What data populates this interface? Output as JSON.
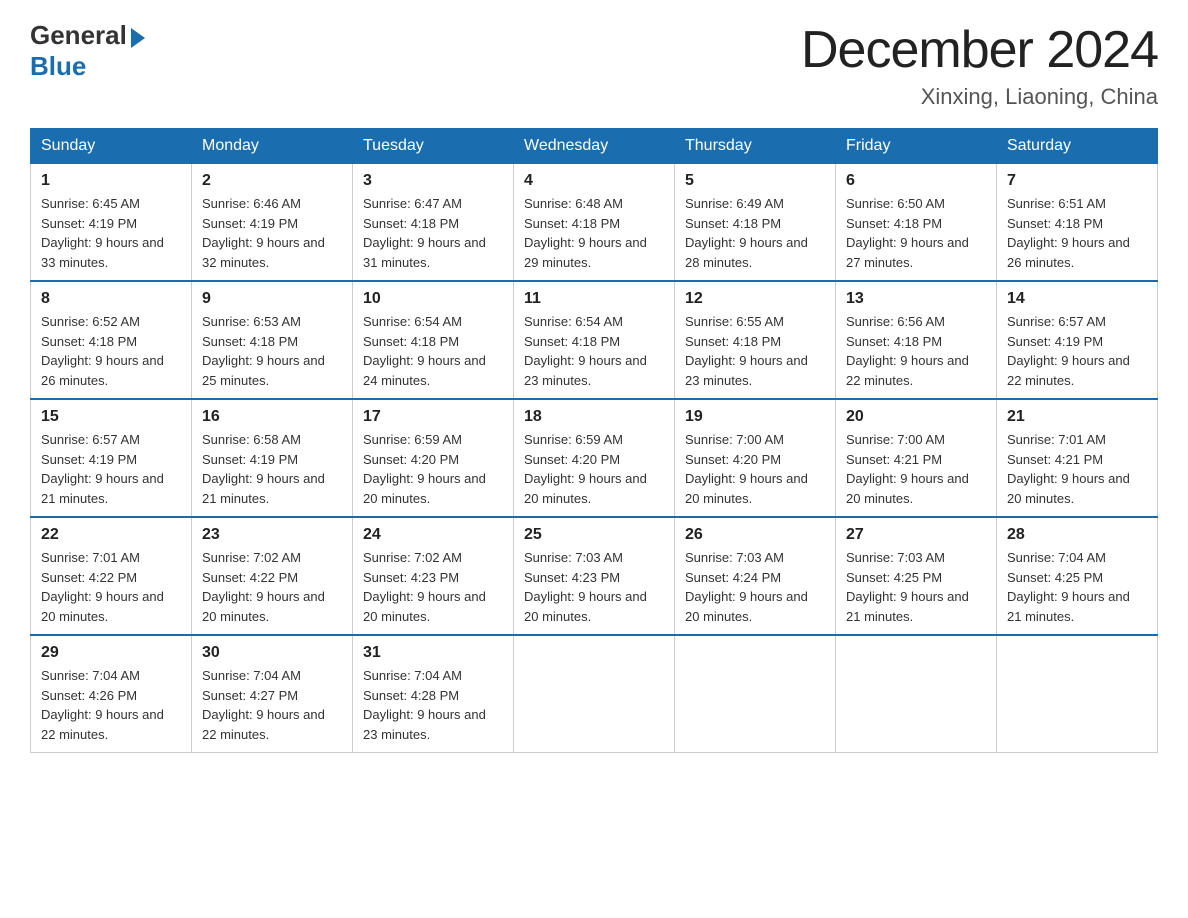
{
  "logo": {
    "general": "General",
    "blue": "Blue"
  },
  "title": {
    "month": "December 2024",
    "location": "Xinxing, Liaoning, China"
  },
  "days": [
    "Sunday",
    "Monday",
    "Tuesday",
    "Wednesday",
    "Thursday",
    "Friday",
    "Saturday"
  ],
  "weeks": [
    [
      {
        "day": 1,
        "sunrise": "6:45 AM",
        "sunset": "4:19 PM",
        "daylight": "9 hours and 33 minutes."
      },
      {
        "day": 2,
        "sunrise": "6:46 AM",
        "sunset": "4:19 PM",
        "daylight": "9 hours and 32 minutes."
      },
      {
        "day": 3,
        "sunrise": "6:47 AM",
        "sunset": "4:18 PM",
        "daylight": "9 hours and 31 minutes."
      },
      {
        "day": 4,
        "sunrise": "6:48 AM",
        "sunset": "4:18 PM",
        "daylight": "9 hours and 29 minutes."
      },
      {
        "day": 5,
        "sunrise": "6:49 AM",
        "sunset": "4:18 PM",
        "daylight": "9 hours and 28 minutes."
      },
      {
        "day": 6,
        "sunrise": "6:50 AM",
        "sunset": "4:18 PM",
        "daylight": "9 hours and 27 minutes."
      },
      {
        "day": 7,
        "sunrise": "6:51 AM",
        "sunset": "4:18 PM",
        "daylight": "9 hours and 26 minutes."
      }
    ],
    [
      {
        "day": 8,
        "sunrise": "6:52 AM",
        "sunset": "4:18 PM",
        "daylight": "9 hours and 26 minutes."
      },
      {
        "day": 9,
        "sunrise": "6:53 AM",
        "sunset": "4:18 PM",
        "daylight": "9 hours and 25 minutes."
      },
      {
        "day": 10,
        "sunrise": "6:54 AM",
        "sunset": "4:18 PM",
        "daylight": "9 hours and 24 minutes."
      },
      {
        "day": 11,
        "sunrise": "6:54 AM",
        "sunset": "4:18 PM",
        "daylight": "9 hours and 23 minutes."
      },
      {
        "day": 12,
        "sunrise": "6:55 AM",
        "sunset": "4:18 PM",
        "daylight": "9 hours and 23 minutes."
      },
      {
        "day": 13,
        "sunrise": "6:56 AM",
        "sunset": "4:18 PM",
        "daylight": "9 hours and 22 minutes."
      },
      {
        "day": 14,
        "sunrise": "6:57 AM",
        "sunset": "4:19 PM",
        "daylight": "9 hours and 22 minutes."
      }
    ],
    [
      {
        "day": 15,
        "sunrise": "6:57 AM",
        "sunset": "4:19 PM",
        "daylight": "9 hours and 21 minutes."
      },
      {
        "day": 16,
        "sunrise": "6:58 AM",
        "sunset": "4:19 PM",
        "daylight": "9 hours and 21 minutes."
      },
      {
        "day": 17,
        "sunrise": "6:59 AM",
        "sunset": "4:20 PM",
        "daylight": "9 hours and 20 minutes."
      },
      {
        "day": 18,
        "sunrise": "6:59 AM",
        "sunset": "4:20 PM",
        "daylight": "9 hours and 20 minutes."
      },
      {
        "day": 19,
        "sunrise": "7:00 AM",
        "sunset": "4:20 PM",
        "daylight": "9 hours and 20 minutes."
      },
      {
        "day": 20,
        "sunrise": "7:00 AM",
        "sunset": "4:21 PM",
        "daylight": "9 hours and 20 minutes."
      },
      {
        "day": 21,
        "sunrise": "7:01 AM",
        "sunset": "4:21 PM",
        "daylight": "9 hours and 20 minutes."
      }
    ],
    [
      {
        "day": 22,
        "sunrise": "7:01 AM",
        "sunset": "4:22 PM",
        "daylight": "9 hours and 20 minutes."
      },
      {
        "day": 23,
        "sunrise": "7:02 AM",
        "sunset": "4:22 PM",
        "daylight": "9 hours and 20 minutes."
      },
      {
        "day": 24,
        "sunrise": "7:02 AM",
        "sunset": "4:23 PM",
        "daylight": "9 hours and 20 minutes."
      },
      {
        "day": 25,
        "sunrise": "7:03 AM",
        "sunset": "4:23 PM",
        "daylight": "9 hours and 20 minutes."
      },
      {
        "day": 26,
        "sunrise": "7:03 AM",
        "sunset": "4:24 PM",
        "daylight": "9 hours and 20 minutes."
      },
      {
        "day": 27,
        "sunrise": "7:03 AM",
        "sunset": "4:25 PM",
        "daylight": "9 hours and 21 minutes."
      },
      {
        "day": 28,
        "sunrise": "7:04 AM",
        "sunset": "4:25 PM",
        "daylight": "9 hours and 21 minutes."
      }
    ],
    [
      {
        "day": 29,
        "sunrise": "7:04 AM",
        "sunset": "4:26 PM",
        "daylight": "9 hours and 22 minutes."
      },
      {
        "day": 30,
        "sunrise": "7:04 AM",
        "sunset": "4:27 PM",
        "daylight": "9 hours and 22 minutes."
      },
      {
        "day": 31,
        "sunrise": "7:04 AM",
        "sunset": "4:28 PM",
        "daylight": "9 hours and 23 minutes."
      },
      null,
      null,
      null,
      null
    ]
  ]
}
